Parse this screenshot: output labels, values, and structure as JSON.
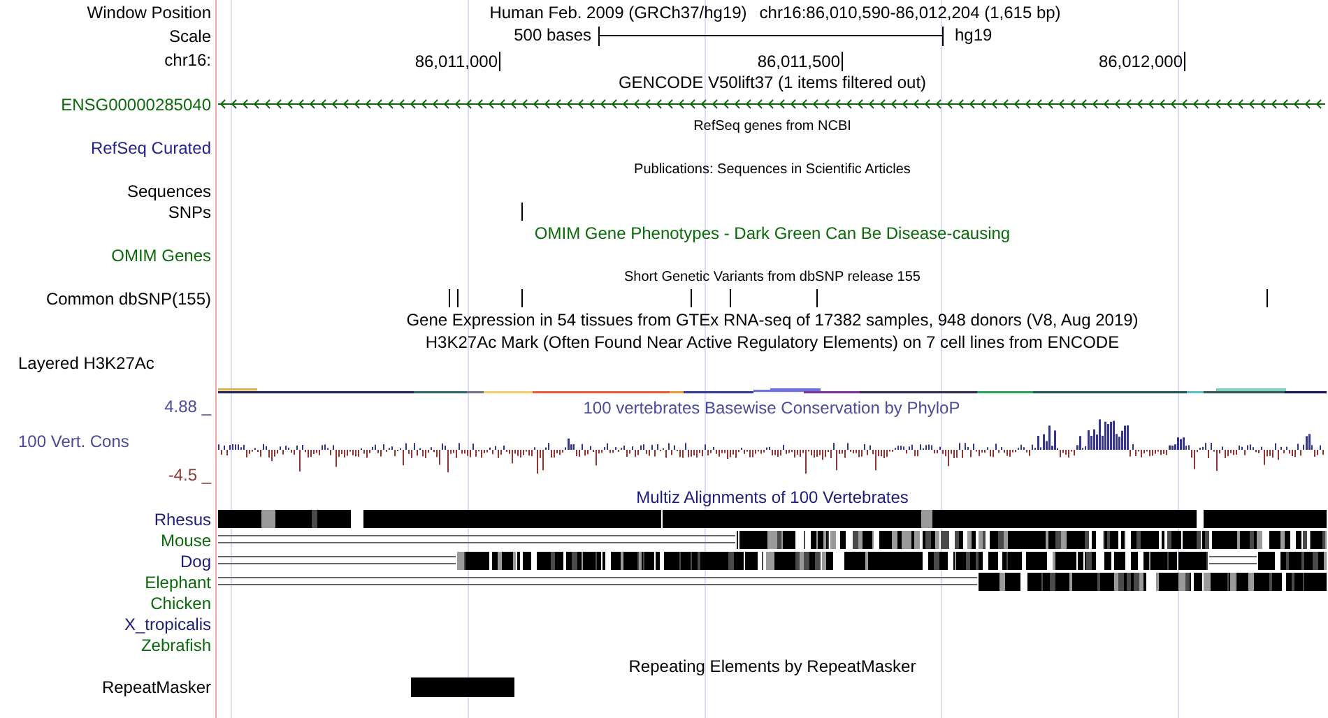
{
  "header": {
    "label": "Window Position",
    "assembly": "Human Feb. 2009 (GRCh37/hg19)",
    "position": "chr16:86,010,590-86,012,204 (1,615 bp)"
  },
  "scale": {
    "label": "Scale",
    "length": "500 bases",
    "assembly": "hg19"
  },
  "ruler": {
    "label": "chr16:",
    "ticks": [
      "86,011,000",
      "86,011,500",
      "86,012,000"
    ]
  },
  "tracks": [
    {
      "title": "GENCODE V50lift37 (1 items filtered out)",
      "small": false,
      "color": "#000000",
      "rows": [
        {
          "kind": "gene",
          "label": "ENSG00000285040",
          "color": "#0a6a0a"
        }
      ]
    },
    {
      "title": "RefSeq genes from NCBI",
      "small": true,
      "color": "#000000",
      "rows": [
        {
          "kind": "empty",
          "label": "RefSeq Curated",
          "color": "#1f1f8f"
        }
      ]
    },
    {
      "title": "Publications: Sequences in Scientific Articles",
      "small": true,
      "color": "#000000",
      "rows": [
        {
          "kind": "empty",
          "label": "Sequences",
          "color": "#000000"
        },
        {
          "kind": "snps",
          "label": "SNPs",
          "color": "#000000"
        }
      ]
    },
    {
      "title": "OMIM Gene Phenotypes - Dark Green Can Be Disease-causing",
      "small": false,
      "color": "#0a6a0a",
      "rows": [
        {
          "kind": "empty",
          "label": "OMIM Genes",
          "color": "#0a6a0a"
        }
      ]
    },
    {
      "title": "Short Genetic Variants from dbSNP release 155",
      "small": true,
      "color": "#000000",
      "rows": [
        {
          "kind": "snps",
          "label": "Common dbSNP(155)",
          "color": "#000000"
        }
      ]
    },
    {
      "title": "Gene Expression in 54 tissues from GTEx RNA-seq of 17382 samples, 948 donors (V8, Aug 2019)",
      "small": false,
      "color": "#000000"
    },
    {
      "title": "H3K27Ac Mark (Often Found Near Active Regulatory Elements) on 7 cell lines from ENCODE",
      "small": false,
      "color": "#000000",
      "rows": [
        {
          "kind": "layered",
          "label": "Layered H3K27Ac",
          "color": "#000000"
        }
      ]
    },
    {
      "title": "100 vertebrates Basewise Conservation by PhyloP",
      "small": false,
      "color": "#4b4b9b",
      "rows": [
        {
          "kind": "wiggle",
          "label": "100 Vert. Cons",
          "color": "#4b4b9b",
          "max": "4.88 _",
          "min": "-4.5 _"
        }
      ]
    },
    {
      "title": "Multiz Alignments of 100 Vertebrates",
      "small": false,
      "color": "#1c1c78",
      "rows": [
        {
          "kind": "alignment",
          "label": "Rhesus",
          "color": "#1c1c78"
        },
        {
          "kind": "alignment",
          "label": "Mouse",
          "color": "#0a6a0a"
        },
        {
          "kind": "alignment",
          "label": "Dog",
          "color": "#1c1c78"
        },
        {
          "kind": "alignment",
          "label": "Elephant",
          "color": "#0a6a0a"
        },
        {
          "kind": "empty",
          "label": "Chicken",
          "color": "#0a6a0a"
        },
        {
          "kind": "empty",
          "label": "X_tropicalis",
          "color": "#1c1c78"
        },
        {
          "kind": "empty",
          "label": "Zebrafish",
          "color": "#0a6a0a"
        }
      ]
    },
    {
      "title": "Repeating Elements by RepeatMasker",
      "small": false,
      "color": "#000000",
      "rows": [
        {
          "kind": "repeat",
          "label": "RepeatMasker",
          "color": "#000000"
        }
      ]
    }
  ]
}
